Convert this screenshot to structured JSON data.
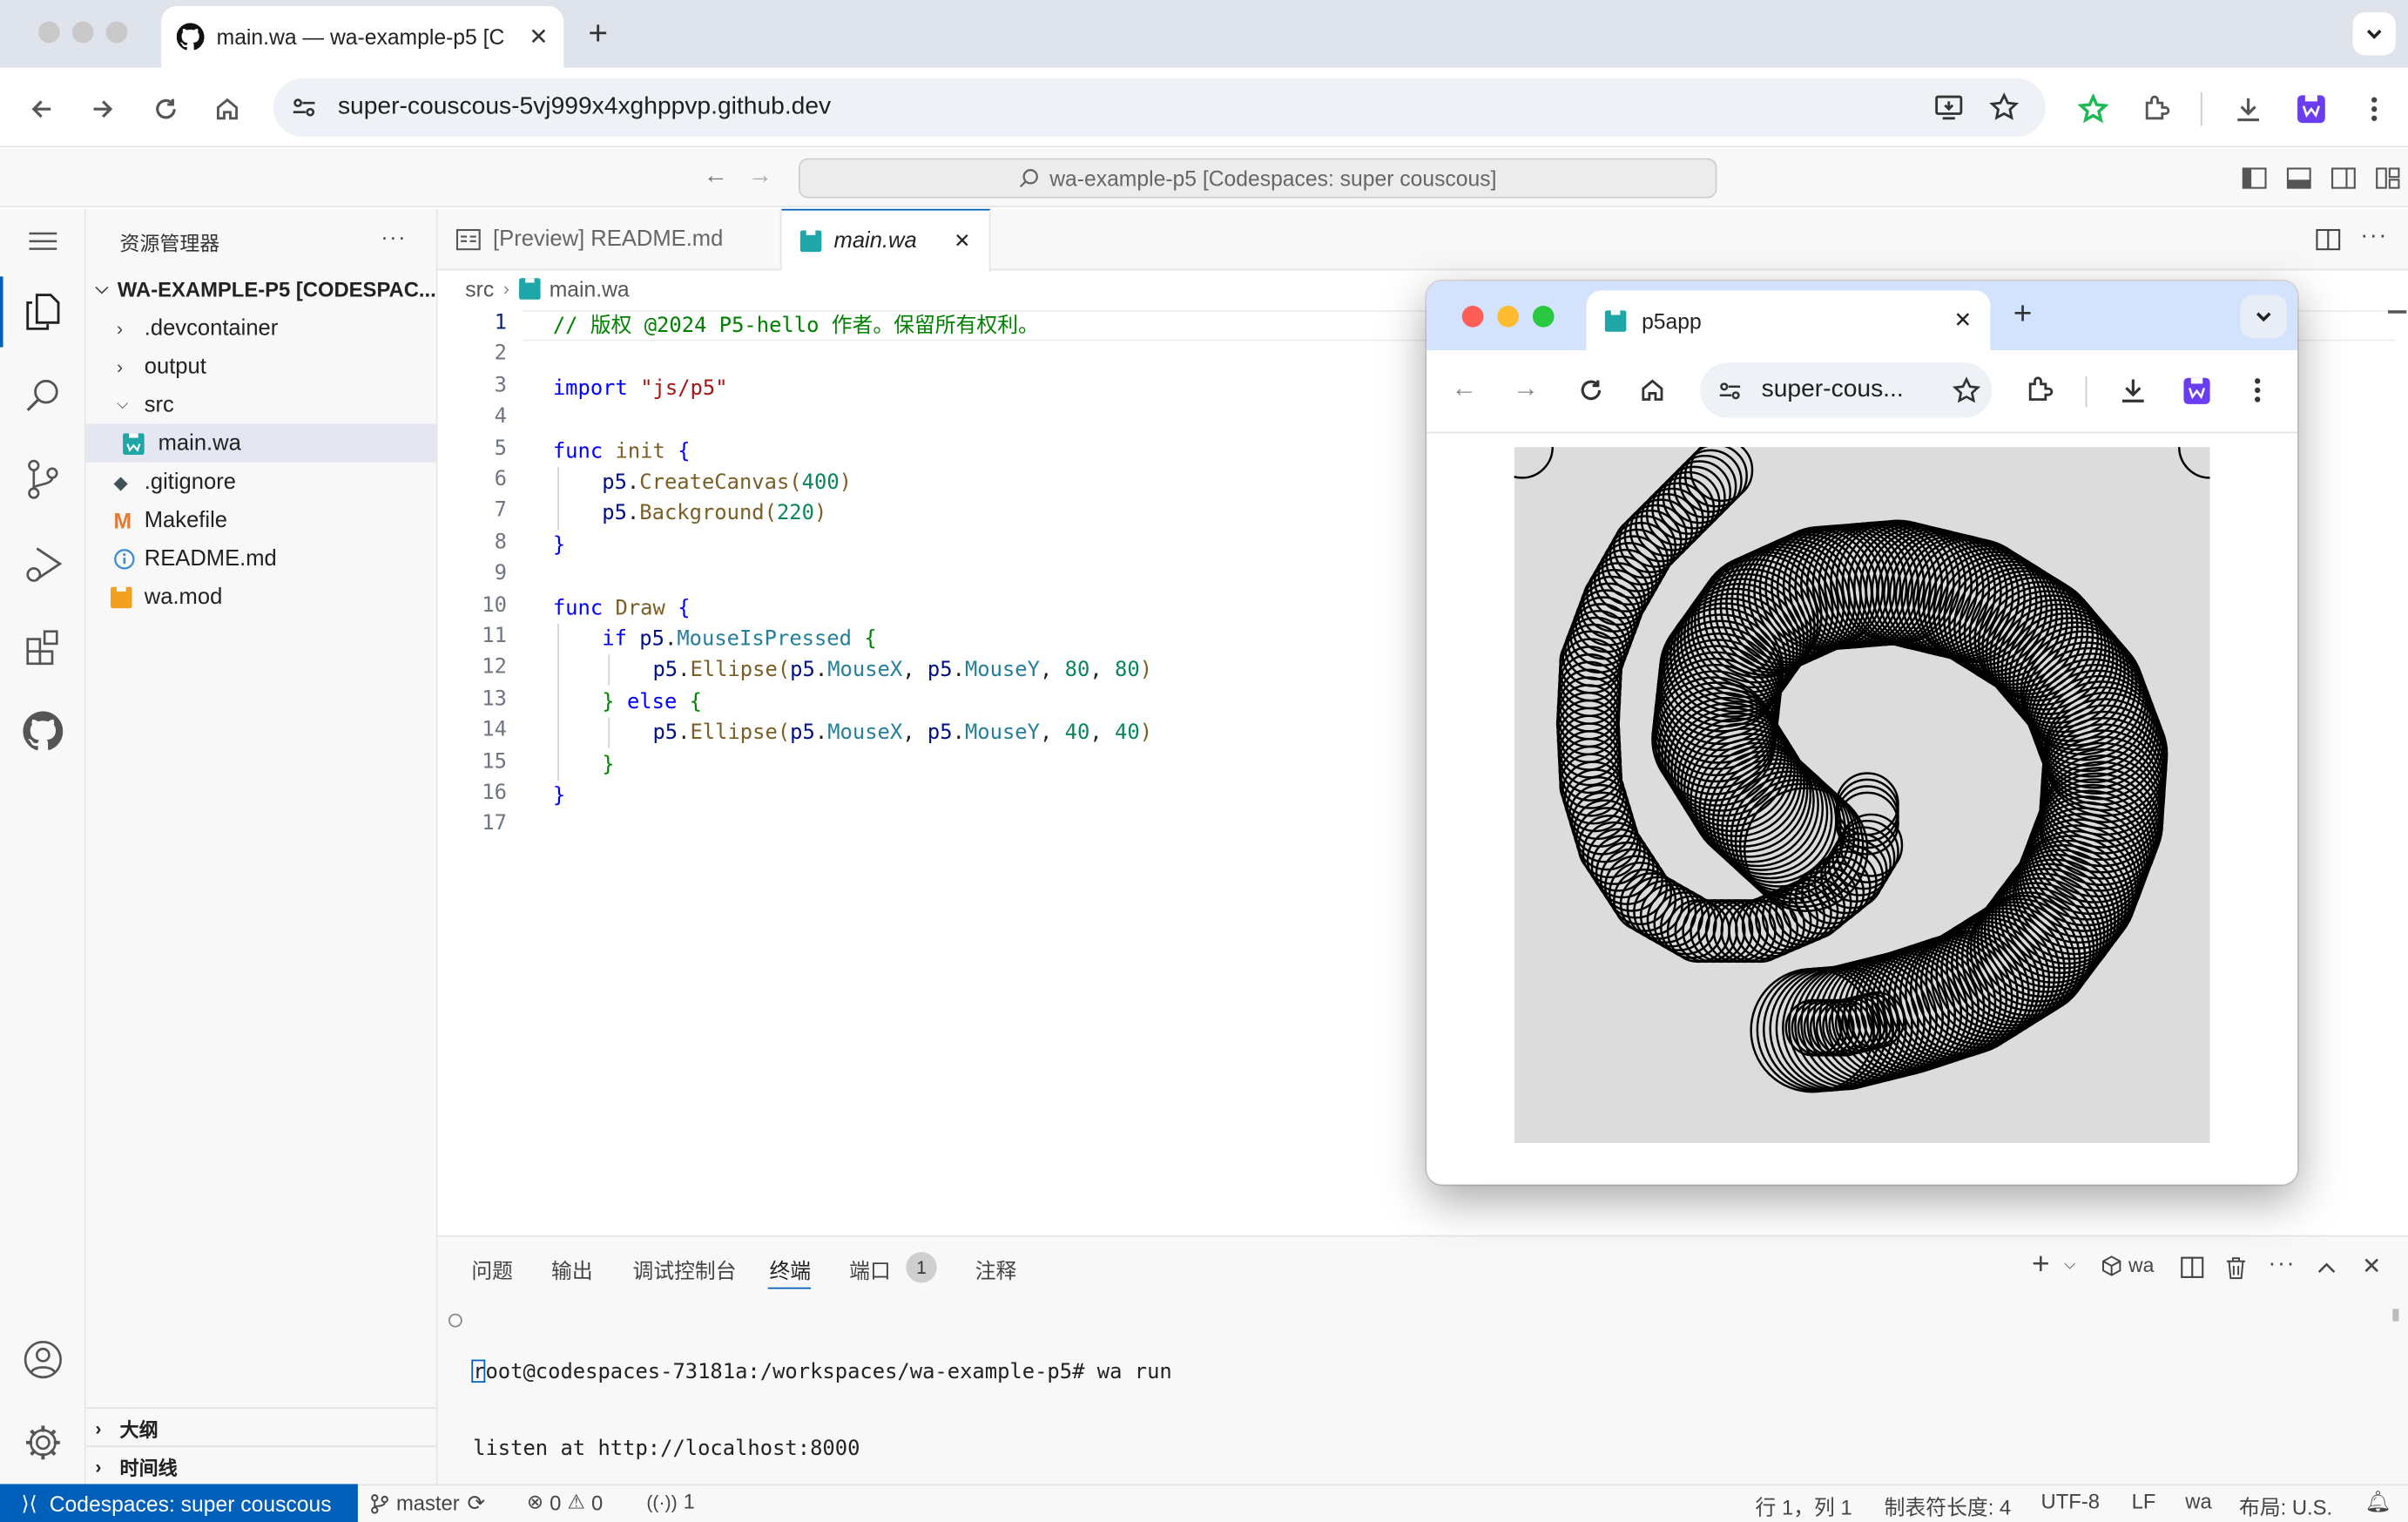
{
  "browser": {
    "tab_title": "main.wa — wa-example-p5 [C",
    "new_tab": "+",
    "url": "super-couscous-5vj999x4xghppvp.github.dev"
  },
  "vscode": {
    "command_center": "wa-example-p5 [Codespaces: super couscous]",
    "explorer_title": "资源管理器",
    "explorer_more": "···",
    "workspace_root": "WA-EXAMPLE-P5 [CODESPAC...",
    "tree": [
      {
        "name": ".devcontainer",
        "kind": "folder"
      },
      {
        "name": "output",
        "kind": "folder"
      },
      {
        "name": "src",
        "kind": "folder-open"
      },
      {
        "name": "main.wa",
        "kind": "wa-file"
      },
      {
        "name": ".gitignore",
        "kind": "git-file"
      },
      {
        "name": "Makefile",
        "kind": "make-file"
      },
      {
        "name": "README.md",
        "kind": "info-file"
      },
      {
        "name": "wa.mod",
        "kind": "mod-file"
      }
    ],
    "outline_label": "大纲",
    "timeline_label": "时间线",
    "editor_tabs": [
      "[Preview] README.md",
      "main.wa"
    ],
    "breadcrumb": [
      "src",
      "main.wa"
    ],
    "line_numbers": [
      "1",
      "2",
      "3",
      "4",
      "5",
      "6",
      "7",
      "8",
      "9",
      "10",
      "11",
      "12",
      "13",
      "14",
      "15",
      "16",
      "17"
    ],
    "code": {
      "l1": "// 版权 @2024 P5-hello 作者。保留所有权利。",
      "import_kw": "import",
      "import_path": "\"js/p5\"",
      "func_kw": "func",
      "init_name": "init",
      "brace_open": "{",
      "brace_close": "}",
      "p5": "p5",
      "dot": ".",
      "create_canvas": "CreateCanvas",
      "arg400": "400",
      "background": "Background",
      "arg220": "220",
      "draw_name": "Draw",
      "if_kw": "if",
      "mouse_pressed": "MouseIsPressed",
      "ellipse": "Ellipse",
      "mouse_x": "MouseX",
      "mouse_y": "MouseY",
      "arg80": "80",
      "arg40": "40",
      "else_kw": "else",
      "lparen": "(",
      "rparen": ")",
      "comma": ", "
    },
    "panel_tabs": [
      "问题",
      "输出",
      "调试控制台",
      "终端",
      "端口",
      "注释"
    ],
    "ports_badge": "1",
    "terminal_shell": "wa",
    "terminal": [
      "root@codespaces-73181a:/workspaces/wa-example-p5# wa run",
      "listen at http://localhost:8000"
    ],
    "status": {
      "remote": "Codespaces: super couscous",
      "branch": "master",
      "errors": "0",
      "warnings": "0",
      "ports": "1",
      "position": "行 1，列 1",
      "tab_size": "制表符长度: 4",
      "encoding": "UTF-8",
      "eol": "LF",
      "language": "wa",
      "layout": "布局: U.S."
    }
  },
  "popup": {
    "tab_title": "p5app",
    "url": "super-cous...",
    "canvas_bg": "#dcdcdc"
  },
  "colors": {
    "accent": "#005fb8",
    "keyword": "#0000ff",
    "function": "#795e26",
    "string": "#a31515",
    "number": "#098658",
    "comment": "#008000"
  }
}
